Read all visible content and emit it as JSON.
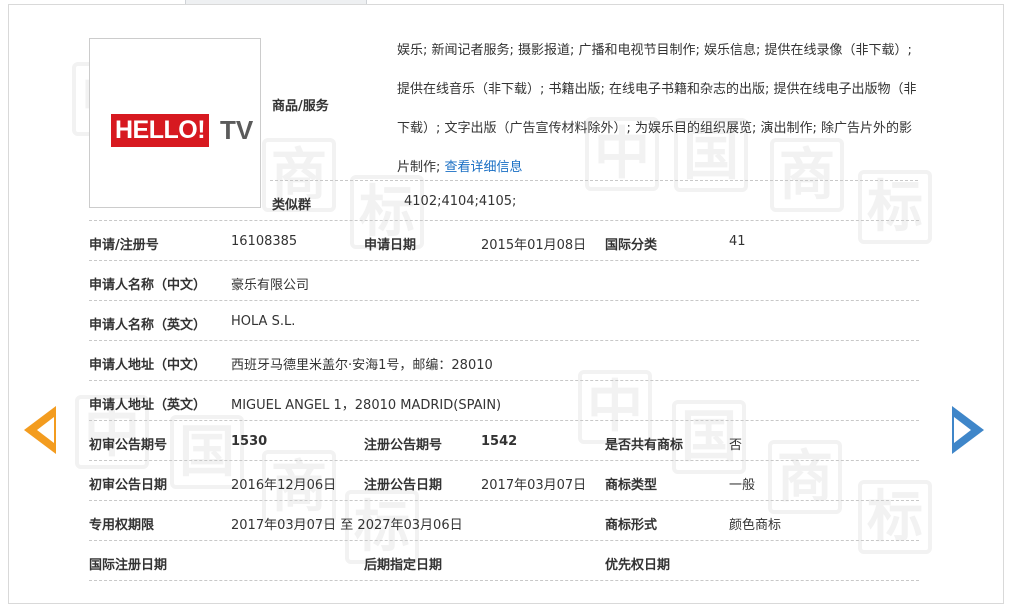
{
  "logo": {
    "brand_main": "HELLO!",
    "brand_tv": "TV",
    "brand_red": "#d71920"
  },
  "goods": {
    "label": "商品/服务",
    "text": "娱乐; 新闻记者服务; 摄影报道; 广播和电视节目制作; 娱乐信息; 提供在线录像（非下载）; 提供在线音乐（非下载）; 书籍出版; 在线电子书籍和杂志的出版; 提供在线电子出版物（非下载）; 文字出版（广告宣传材料除外）; 为娱乐目的组织展览; 演出制作; 除广告片外的影片制作;",
    "detail_link": "查看详细信息"
  },
  "similar_group": {
    "label": "类似群",
    "value": "4102;4104;4105;"
  },
  "fields": {
    "reg_no_label": "申请/注册号",
    "reg_no": "16108385",
    "apply_date_label": "申请日期",
    "apply_date": "2015年01月08日",
    "intl_class_label": "国际分类",
    "intl_class": "41",
    "applicant_cn_label": "申请人名称（中文）",
    "applicant_cn": "豪乐有限公司",
    "applicant_en_label": "申请人名称（英文）",
    "applicant_en": "HOLA S.L.",
    "addr_cn_label": "申请人地址（中文）",
    "addr_cn": "西班牙马德里米盖尔·安海1号，邮编：28010",
    "addr_en_label": "申请人地址（英文）",
    "addr_en": "MIGUEL ANGEL 1，28010 MADRID(SPAIN)",
    "prelim_no_label": "初审公告期号",
    "prelim_no": "1530",
    "reg_pub_no_label": "注册公告期号",
    "reg_pub_no": "1542",
    "shared_label": "是否共有商标",
    "shared": "否",
    "prelim_date_label": "初审公告日期",
    "prelim_date": "2016年12月06日",
    "reg_pub_date_label": "注册公告日期",
    "reg_pub_date": "2017年03月07日",
    "tm_type_label": "商标类型",
    "tm_type": "一般",
    "excl_period_label": "专用权期限",
    "excl_period": "2017年03月07日 至 2027年03月06日",
    "tm_form_label": "商标形式",
    "tm_form": "颜色商标",
    "intl_reg_date_label": "国际注册日期",
    "later_date_label": "后期指定日期",
    "priority_date_label": "优先权日期"
  },
  "nav": {
    "prev_color": "#f39c1f",
    "next_color": "#3f86c9"
  }
}
